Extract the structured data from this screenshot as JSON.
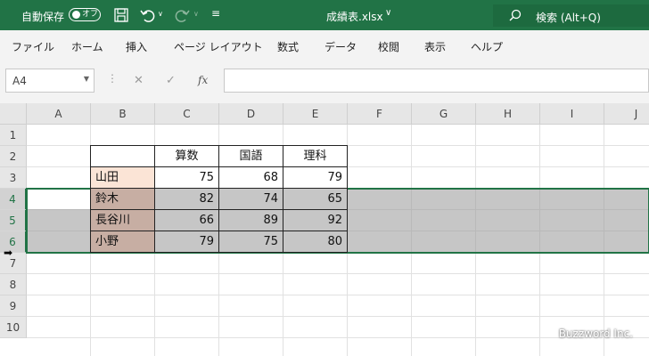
{
  "titlebar": {
    "autosave_label": "自動保存",
    "autosave_state": "オフ",
    "filename": "成績表.xlsx",
    "search_label": "検索 (Alt+Q)",
    "bg_color": "#217346"
  },
  "ribbon": {
    "tabs": [
      "ファイル",
      "ホーム",
      "挿入",
      "ページ レイアウト",
      "数式",
      "データ",
      "校閲",
      "表示",
      "ヘルプ"
    ]
  },
  "formula": {
    "namebox": "A4",
    "fx_label": "fx",
    "value": ""
  },
  "sheet": {
    "columns": [
      "A",
      "B",
      "C",
      "D",
      "E",
      "F",
      "G",
      "H",
      "I",
      "J"
    ],
    "rows": [
      "1",
      "2",
      "3",
      "4",
      "5",
      "6",
      "7",
      "8",
      "9",
      "10"
    ],
    "selected_rows": [
      "4",
      "5",
      "6"
    ],
    "header_row": {
      "math": "算数",
      "japanese": "国語",
      "science": "理科"
    },
    "records": [
      {
        "name": "山田",
        "math": "75",
        "japanese": "68",
        "science": "79"
      },
      {
        "name": "鈴木",
        "math": "82",
        "japanese": "74",
        "science": "65"
      },
      {
        "name": "長谷川",
        "math": "66",
        "japanese": "89",
        "science": "92"
      },
      {
        "name": "小野",
        "math": "79",
        "japanese": "75",
        "science": "80"
      }
    ],
    "name_fill_color": "#fbe4d6",
    "selection_color": "#c6c6c6",
    "accent_color": "#217346"
  },
  "watermark": "Buzzword Inc."
}
